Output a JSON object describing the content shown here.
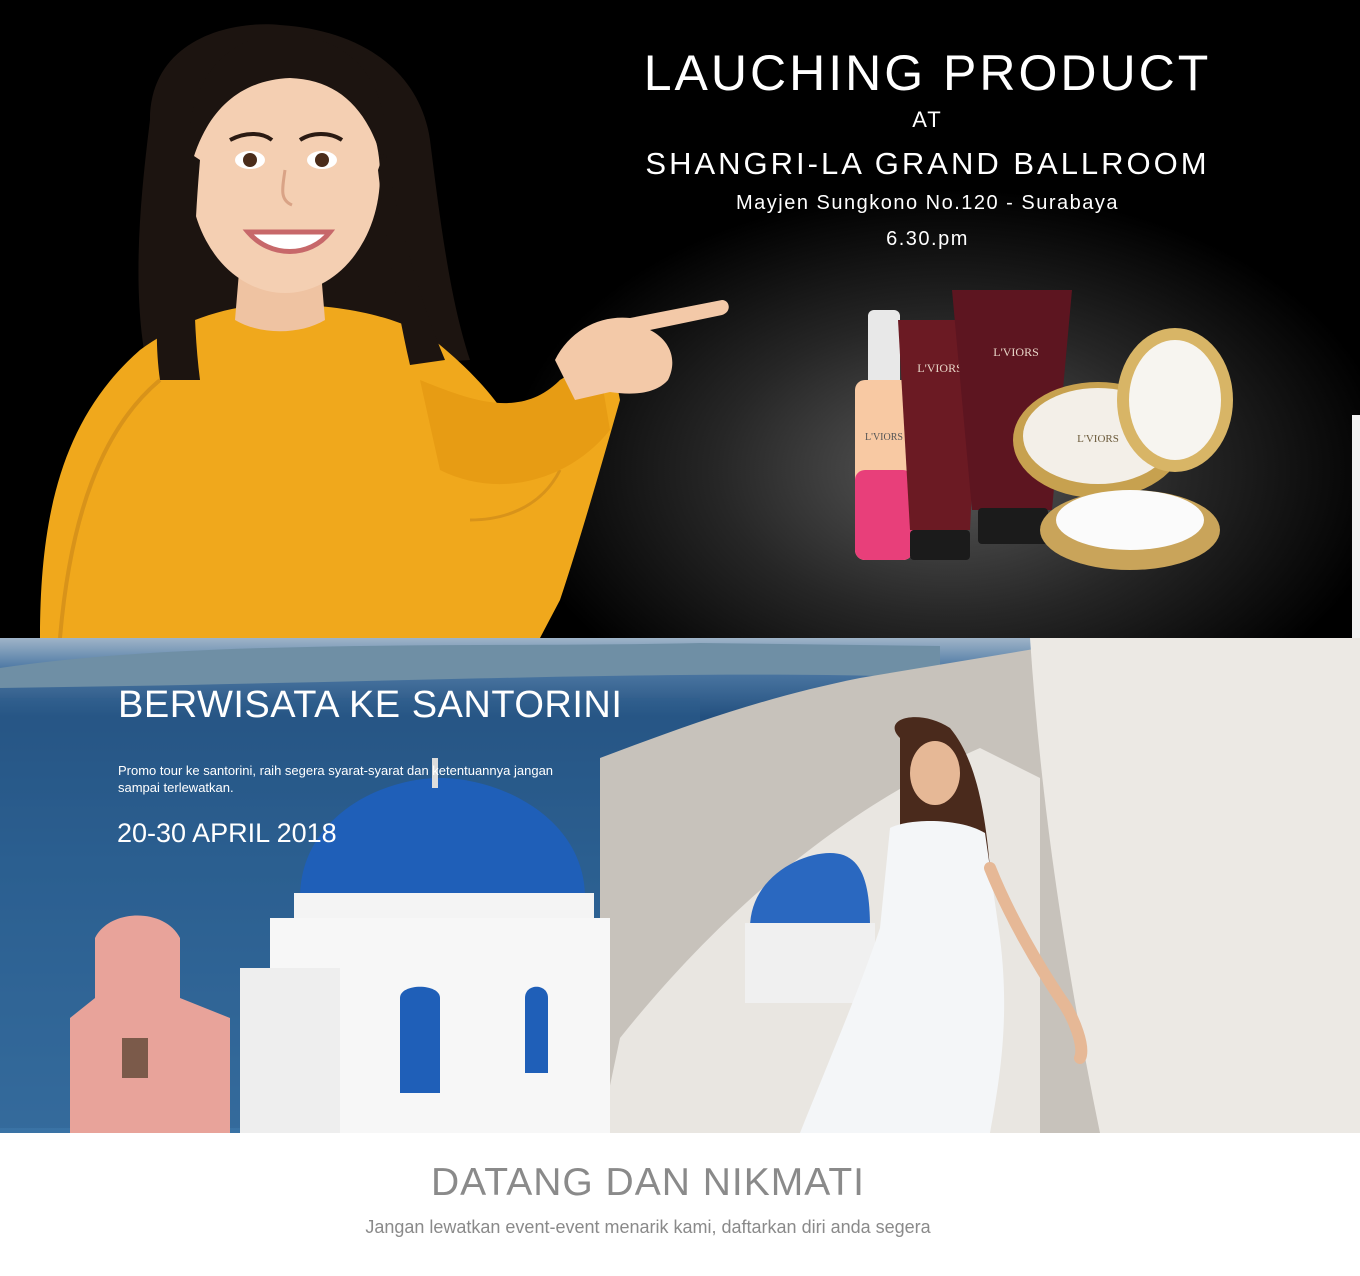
{
  "banner1": {
    "title": "LAUCHING PRODUCT",
    "at": "AT",
    "venue": "SHANGRI-LA GRAND BALLROOM",
    "address": "Mayjen Sungkono No.120 - Surabaya",
    "time": "6.30.pm",
    "brand": "L'VIORS",
    "colors": {
      "sweater": "#f0a81c",
      "background": "#000000"
    }
  },
  "banner2": {
    "title": "BERWISATA KE SANTORINI",
    "description": "Promo tour ke santorini, raih segera syarat-syarat dan ketentuannya jangan sampai terlewatkan.",
    "date": "20-30 APRIL 2018",
    "colors": {
      "dome": "#1f5fb8",
      "sea": "#2a5f91"
    }
  },
  "footer": {
    "title": "DATANG DAN NIKMATI",
    "subtitle": "Jangan lewatkan event-event menarik kami, daftarkan diri anda segera"
  }
}
